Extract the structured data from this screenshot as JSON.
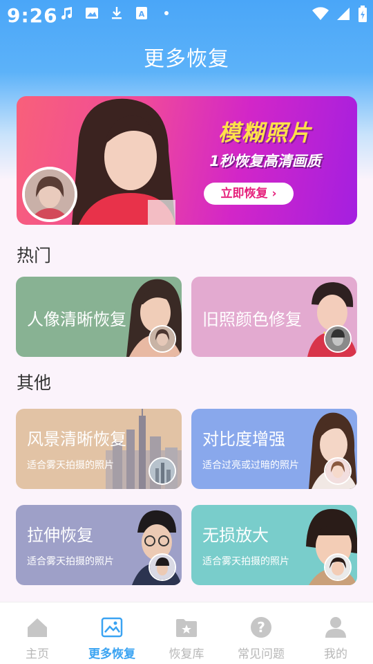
{
  "status_bar": {
    "time": "9:26"
  },
  "header": {
    "title": "更多恢复"
  },
  "banner": {
    "title": "模糊照片",
    "subtitle": "1秒恢复高清画质",
    "button_label": "立即恢复 ›"
  },
  "sections": {
    "hot": "热门",
    "other": "其他"
  },
  "hot_cards": [
    {
      "title": "人像清晰恢复",
      "color": "#88b293"
    },
    {
      "title": "旧照颜色修复",
      "color": "#e3aad0"
    }
  ],
  "other_cards": [
    {
      "title": "风景清晰恢复",
      "subtitle": "适合雾天拍摄的照片",
      "color": "#e2c3a5"
    },
    {
      "title": "对比度增强",
      "subtitle": "适合过亮或过暗的照片",
      "color": "#89a8ec"
    },
    {
      "title": "拉伸恢复",
      "subtitle": "适合雾天拍摄的照片",
      "color": "#9ea0c8"
    },
    {
      "title": "无损放大",
      "subtitle": "适合雾天拍摄的照片",
      "color": "#79cdcb"
    }
  ],
  "bottom_nav": [
    {
      "label": "主页",
      "icon": "home-icon",
      "active": false
    },
    {
      "label": "更多恢复",
      "icon": "image-icon",
      "active": true
    },
    {
      "label": "恢复库",
      "icon": "folder-star-icon",
      "active": false
    },
    {
      "label": "常见问题",
      "icon": "question-icon",
      "active": false
    },
    {
      "label": "我的",
      "icon": "user-icon",
      "active": false
    }
  ],
  "colors": {
    "accent": "#3aa3f2",
    "nav_inactive": "#b7b7b7",
    "banner_title": "#ffe14a",
    "banner_button_text": "#e6237d"
  }
}
